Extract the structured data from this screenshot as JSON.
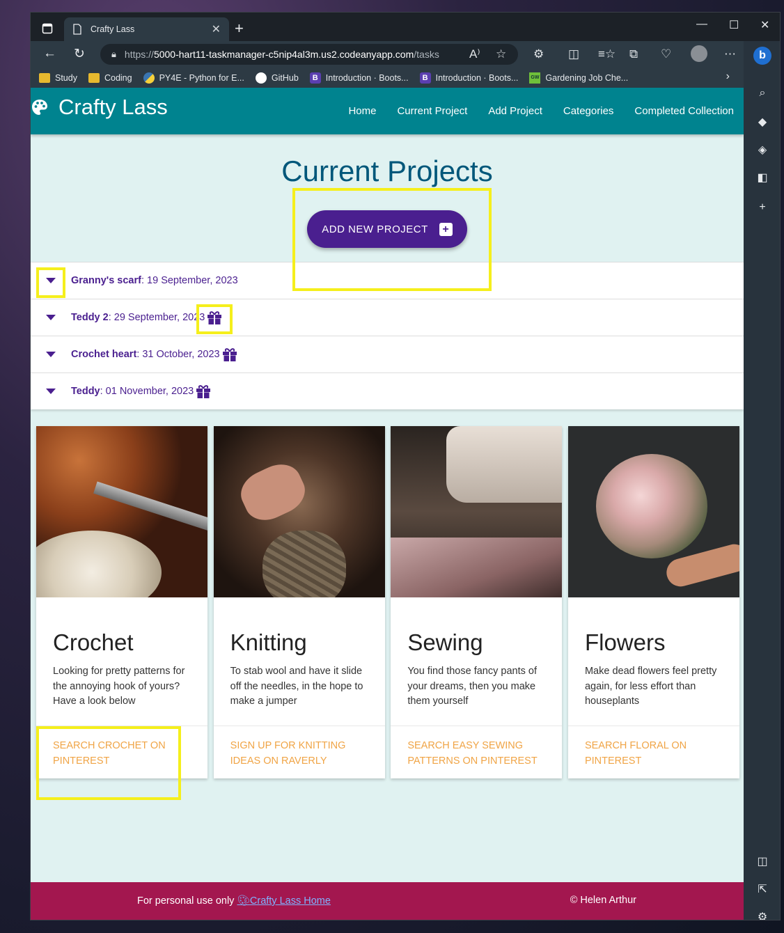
{
  "browser": {
    "tab_title": "Crafty Lass",
    "url_scheme": "https://",
    "url_host": "5000-hart11-taskmanager-c5nip4al3m.us2.codeanyapp.com",
    "url_path": "/tasks",
    "bookmarks": [
      {
        "label": "Study",
        "icon": "folder-icon"
      },
      {
        "label": "Coding",
        "icon": "folder-icon"
      },
      {
        "label": "PY4E - Python for E...",
        "icon": "python-icon"
      },
      {
        "label": "GitHub",
        "icon": "github-icon"
      },
      {
        "label": "Introduction · Boots...",
        "icon": "bootstrap-icon"
      },
      {
        "label": "Introduction · Boots...",
        "icon": "bootstrap-icon"
      },
      {
        "label": "Gardening Job Che...",
        "icon": "gw-icon"
      }
    ]
  },
  "site": {
    "brand": "Crafty Lass",
    "nav": [
      "Home",
      "Current Project",
      "Add Project",
      "Categories",
      "Completed Collection"
    ],
    "page_title": "Current Projects",
    "add_button": "ADD NEW PROJECT",
    "projects": [
      {
        "name": "Granny's scarf",
        "date": ": 19 September, 2023",
        "gift": false
      },
      {
        "name": "Teddy 2",
        "date": ": 29 September, 2023",
        "gift": true
      },
      {
        "name": "Crochet heart",
        "date": ": 31 October, 2023",
        "gift": true
      },
      {
        "name": "Teddy",
        "date": ": 01 November, 2023",
        "gift": true
      }
    ],
    "cards": [
      {
        "title": "Crochet",
        "text": "Looking for pretty patterns for the annoying hook of yours? Have a look below",
        "action": "SEARCH CROCHET ON PINTEREST"
      },
      {
        "title": "Knitting",
        "text": "To stab wool and have it slide off the needles, in the hope to make a jumper",
        "action": "SIGN UP FOR KNITTING IDEAS ON RAVERLY"
      },
      {
        "title": "Sewing",
        "text": "You find those fancy pants of your dreams, then you make them yourself",
        "action": "SEARCH EASY SEWING PATTERNS ON PINTEREST"
      },
      {
        "title": "Flowers",
        "text": "Make dead flowers feel pretty again, for less effort than houseplants",
        "action": "SEARCH FLORAL ON PINTEREST"
      }
    ],
    "footer_left": "For personal use only",
    "footer_link": "Crafty Lass Home",
    "footer_right": "© Helen Arthur"
  },
  "colors": {
    "navbar": "#00838f",
    "accent_purple": "#4a1f8f",
    "footer": "#a3174f",
    "card_action": "#f0a445",
    "highlight": "#f5ef1c"
  }
}
